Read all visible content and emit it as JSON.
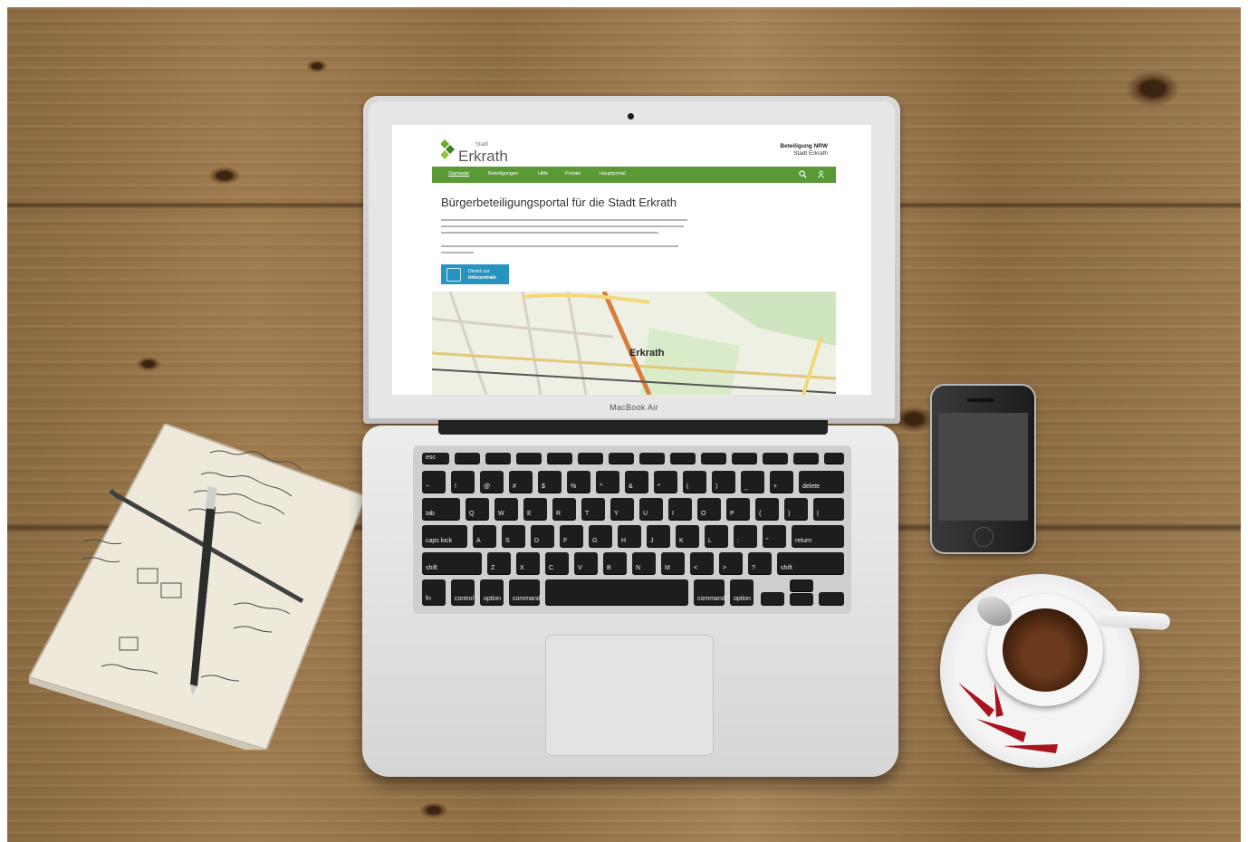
{
  "laptop": {
    "brand_label": "MacBook Air",
    "website": {
      "logo_small": "Stadt",
      "logo_big": "Erkrath",
      "portal_title_line1": "Beteiligung NRW",
      "portal_title_line2": "Stadt Erkrath",
      "nav": [
        {
          "label": "Startseite"
        },
        {
          "label": "Beteiligungen"
        },
        {
          "label": "Hilfe"
        },
        {
          "label": "Portale"
        },
        {
          "label": "Hauptportal"
        }
      ],
      "page_heading": "Bürgerbeteiligungsportal für die Stadt Erkrath",
      "cta_line1": "Direkt zur",
      "cta_line2": "Infozentrale",
      "map_label": "Erkrath",
      "colors": {
        "nav": "#5a9a36",
        "cta": "#2794c0",
        "logo_green": "#6bab2a"
      }
    },
    "keyboard": {
      "row1": [
        "esc",
        "",
        "",
        "",
        "",
        "",
        "",
        "",
        "",
        "",
        "",
        "",
        ""
      ],
      "row2": [
        "~",
        "!",
        "@",
        "#",
        "$",
        "%",
        "^",
        "&",
        "*",
        "(",
        ")",
        "_",
        "+",
        "delete"
      ],
      "row3": [
        "tab",
        "Q",
        "W",
        "E",
        "R",
        "T",
        "Y",
        "U",
        "I",
        "O",
        "P",
        "{",
        "}",
        "|"
      ],
      "row4": [
        "caps lock",
        "A",
        "S",
        "D",
        "F",
        "G",
        "H",
        "J",
        "K",
        "L",
        ":",
        "\"",
        "return"
      ],
      "row5": [
        "shift",
        "Z",
        "X",
        "C",
        "V",
        "B",
        "N",
        "M",
        "<",
        ">",
        "?",
        "shift"
      ],
      "row6": [
        "fn",
        "control",
        "option",
        "command",
        "",
        "command",
        "option"
      ]
    }
  },
  "icons": {
    "search": "search-icon",
    "user": "user-icon"
  }
}
